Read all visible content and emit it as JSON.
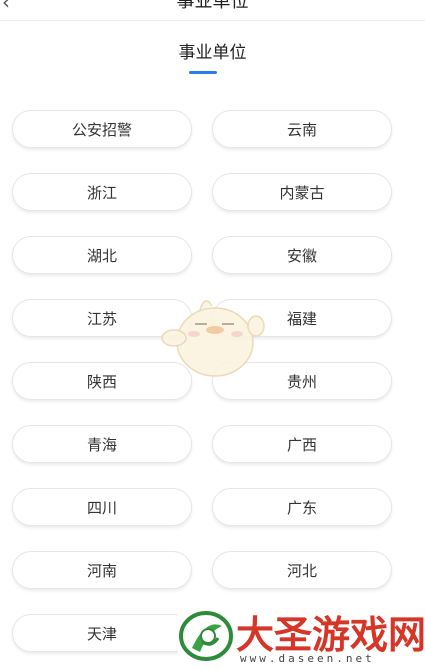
{
  "header": {
    "back_icon": "chevron-left-icon",
    "title": "事业单位"
  },
  "tab": {
    "label": "事业单位",
    "underline_color": "#2d7bf0"
  },
  "regions": [
    {
      "left": "公安招警",
      "right": "云南"
    },
    {
      "left": "浙江",
      "right": "内蒙古"
    },
    {
      "left": "湖北",
      "right": "安徽"
    },
    {
      "left": "江苏",
      "right": "福建"
    },
    {
      "left": "陕西",
      "right": "贵州"
    },
    {
      "left": "青海",
      "right": "广西"
    },
    {
      "left": "四川",
      "right": "广东"
    },
    {
      "left": "河南",
      "right": "河北"
    },
    {
      "left": "天津",
      "right": ""
    }
  ],
  "watermark": {
    "brand": "大圣游戏网",
    "url": "www.daseen.net",
    "brand_color": "#d63628"
  }
}
